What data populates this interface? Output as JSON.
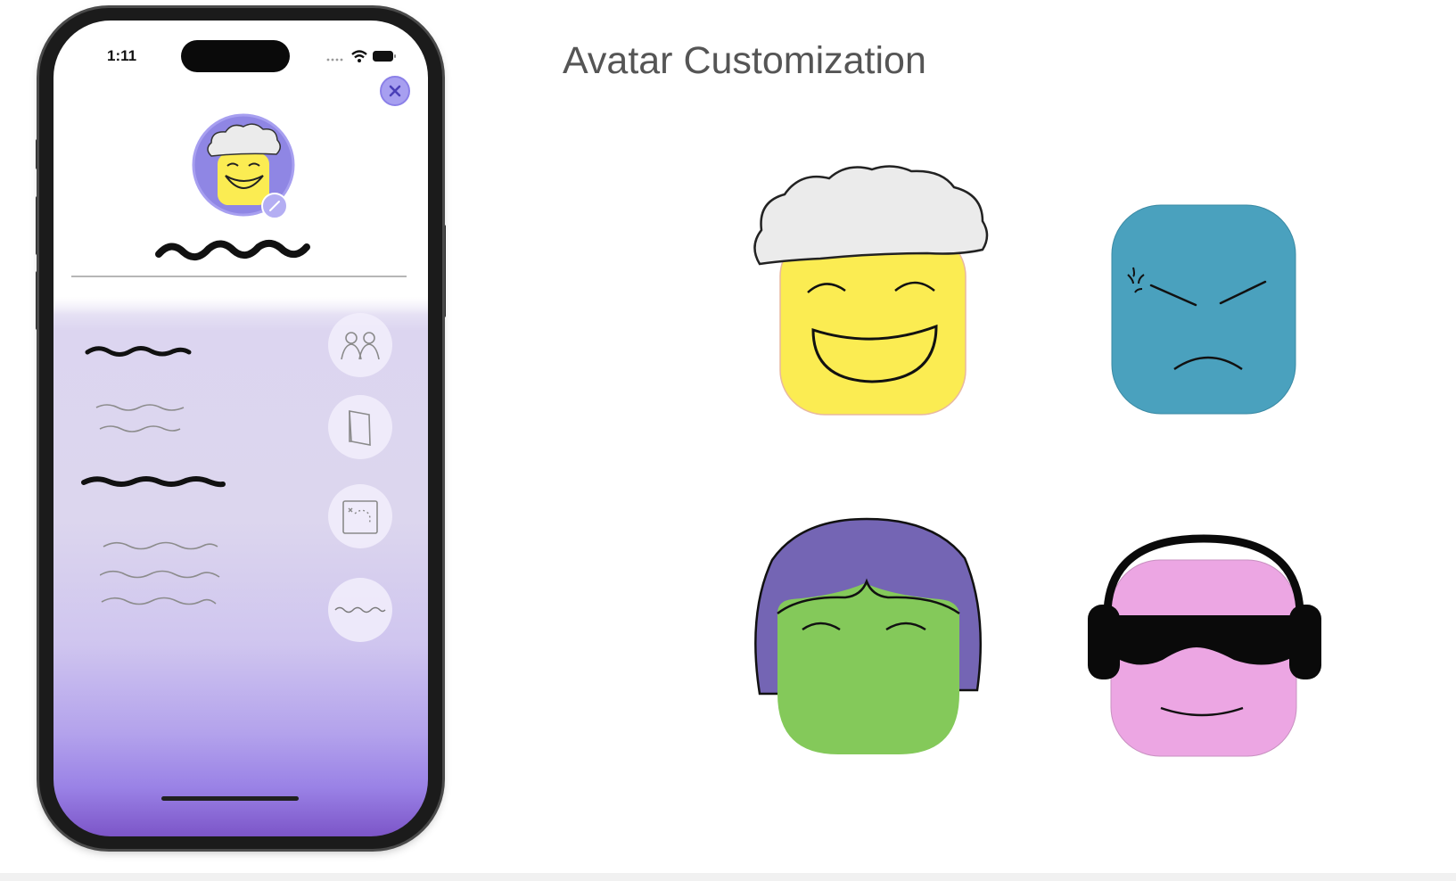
{
  "page": {
    "title": "Avatar Customization"
  },
  "phone": {
    "status_time": "1:11",
    "status_icons": [
      "signal-dots-icon",
      "wifi-icon",
      "battery-icon"
    ],
    "close_icon": "close-icon",
    "edit_icon": "pencil-icon",
    "current_avatar": "yellow-cloud-hair-avatar",
    "side_actions": [
      {
        "icon": "people-icon"
      },
      {
        "icon": "book-icon"
      },
      {
        "icon": "map-icon"
      },
      {
        "icon": "wave-icon"
      }
    ],
    "colors": {
      "accent": "#a79ff0",
      "gradient_bottom": "#7c55c8",
      "panel": "#dcd5f0"
    }
  },
  "avatars": [
    {
      "id": "yellow-happy-cloud-hair",
      "face_color": "#fbec52",
      "hair_color": "#ebebeb"
    },
    {
      "id": "blue-angry",
      "face_color": "#4aa1be"
    },
    {
      "id": "green-purple-hair",
      "face_color": "#84c95a",
      "hair_color": "#7465b4"
    },
    {
      "id": "pink-headphones-sunglasses",
      "face_color": "#eca6e3"
    }
  ]
}
